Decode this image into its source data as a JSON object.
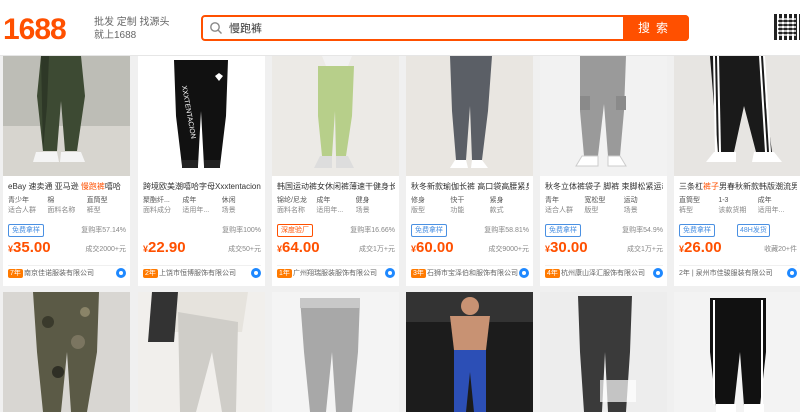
{
  "header": {
    "logo": "1688",
    "slogan_line1": "批发 定制 找源头",
    "slogan_line2": "就上1688",
    "search": {
      "value": "慢跑裤",
      "button": "搜索"
    }
  },
  "products": [
    {
      "title_a": "eBay 速卖通 亚马逊 ",
      "title_hl": "慢跑裤",
      "title_b": "嘻哈",
      "attrs": [
        [
          "青少年",
          "适合人群"
        ],
        [
          "棉",
          "面料名称"
        ],
        [
          "直筒型",
          "裤型"
        ]
      ],
      "tag": "免费拿样",
      "tag2": "",
      "rebuy": "复购率57.14%",
      "price_sym": "¥",
      "price": "35.00",
      "sold": "成交2000+元",
      "years": "7年",
      "shop": "南京佳诺服装有限公司"
    },
    {
      "title_a": "跨境欧美潮嘻哈字母Xxxtentacion卫裤休",
      "title_hl": "",
      "title_b": "",
      "attrs": [
        [
          "聚酯纤...",
          "面料成分"
        ],
        [
          "成年",
          "适用年..."
        ],
        [
          "休闲",
          "场景"
        ]
      ],
      "tag": "",
      "tag2": "",
      "rebuy": "复购率100%",
      "price_sym": "¥",
      "price": "22.90",
      "sold": "成交50+元",
      "years": "2年",
      "shop": "上饶市恒博服饰有限公司"
    },
    {
      "title_a": "韩国运动裤女休闲裤薄速干健身长裤高",
      "title_hl": "",
      "title_b": "",
      "attrs": [
        [
          "锦纶/尼龙",
          "面料名称"
        ],
        [
          "成年",
          "适用年..."
        ],
        [
          "健身",
          "场景"
        ]
      ],
      "tag": "深度验厂",
      "tag2": "",
      "rebuy": "复购率16.66%",
      "price_sym": "¥",
      "price": "64.00",
      "sold": "成交1万+元",
      "years": "1年",
      "shop": "广州翔瑞服装服饰有限公司"
    },
    {
      "title_a": "秋冬新款瑜伽长裤 高口袋高腰紧身瑜",
      "title_hl": "",
      "title_b": "",
      "attrs": [
        [
          "修身",
          "版型"
        ],
        [
          "快干",
          "功能"
        ],
        [
          "紧身",
          "款式"
        ]
      ],
      "tag": "免费拿样",
      "tag2": "",
      "rebuy": "复购率58.81%",
      "price_sym": "¥",
      "price": "60.00",
      "sold": "成交9000+元",
      "years": "3年",
      "shop": "石狮市宝泽伯和服饰有限公司"
    },
    {
      "title_a": "秋冬立体裤袋子 脚裤 束脚松紧运动跨",
      "title_hl": "",
      "title_b": "",
      "attrs": [
        [
          "青年",
          "适合人群"
        ],
        [
          "宽松型",
          "版型"
        ],
        [
          "运动",
          "场景"
        ]
      ],
      "tag": "免费拿样",
      "tag2": "",
      "rebuy": "复购率54.9%",
      "price_sym": "¥",
      "price": "30.00",
      "sold": "成交1万+元",
      "years": "4年",
      "shop": "杭州康山泽汇服饰有限公司"
    },
    {
      "title_a": "三条杠",
      "title_hl": "裤子",
      "title_b": "男春秋新款韩版潮流男士",
      "attrs": [
        [
          "直筒型",
          "裤型"
        ],
        [
          "1-3",
          "该款货期"
        ],
        [
          "成年",
          "适用年..."
        ]
      ],
      "tag": "免费拿样",
      "tag2": "48H发货",
      "rebuy": "",
      "price_sym": "¥",
      "price": "26.00",
      "sold": "收藏20+件",
      "years": "",
      "shop": "2年 | 泉州市佳骏服装有限公司"
    }
  ],
  "icons": {
    "search": "search-icon",
    "wangwang": "wangwang-chat-icon",
    "qr": "qr-code-icon"
  },
  "colors": {
    "accent": "#ff5000",
    "link": "#4a90e2"
  }
}
